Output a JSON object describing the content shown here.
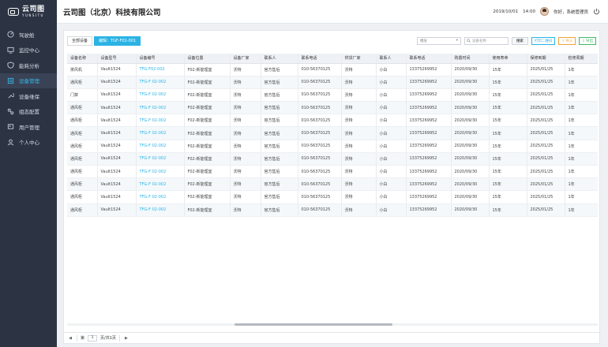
{
  "brand": {
    "cn": "云司图",
    "en": "YUNSITU"
  },
  "header": {
    "company": "云司图（北京）科技有限公司",
    "date": "2019/10/01",
    "time": "14:00",
    "greeting": "你好，系统管理员"
  },
  "sidebar": {
    "items": [
      {
        "label": "驾驶舱",
        "icon": "dashboard-icon",
        "active": false
      },
      {
        "label": "监控中心",
        "icon": "monitor-icon",
        "active": false
      },
      {
        "label": "能耗分析",
        "icon": "shield-icon",
        "active": false
      },
      {
        "label": "设备管理",
        "icon": "device-icon",
        "active": true
      },
      {
        "label": "设备维保",
        "icon": "wrench-icon",
        "active": false
      },
      {
        "label": "组态配置",
        "icon": "config-icon",
        "active": false
      },
      {
        "label": "用户管理",
        "icon": "users-icon",
        "active": false
      },
      {
        "label": "个人中心",
        "icon": "user-icon",
        "active": false
      }
    ]
  },
  "toolbar": {
    "all_devices": "全部设备",
    "filter_tag": "编辑：TGF-F01-001",
    "select_value": "楼层",
    "search_placeholder": "设备名称",
    "search_button": "搜索",
    "qr_button": "打印二维码",
    "import_button": "导入",
    "export_button": "导出"
  },
  "table": {
    "columns": [
      "设备名称",
      "设备型号",
      "设备编号",
      "设备位置",
      "设备厂家",
      "联系人",
      "联系电话",
      "供货厂家",
      "联系人",
      "联系电话",
      "购置时间",
      "使用寿命",
      "保修到期",
      "检修周期"
    ],
    "rows": [
      [
        "排风机",
        "Vault1524",
        "TFG-F02-002",
        "F02-新能理室",
        "沃特",
        "官方售后",
        "010-56370125",
        "沃特",
        "小白",
        "13375269952",
        "2020/09/30",
        "15年",
        "2025/01/25",
        "1年"
      ],
      [
        "通风柜",
        "Vault1524",
        "TFG-F 02-002",
        "F02-新能理室",
        "沃特",
        "官方售后",
        "010-56370125",
        "沃特",
        "小白",
        "13375269952",
        "2020/09/30",
        "15年",
        "2025/01/25",
        "1年"
      ],
      [
        "门禁",
        "Vault1524",
        "TFG-F 02-002",
        "F02-新能理室",
        "沃特",
        "官方售后",
        "010-56370125",
        "沃特",
        "小白",
        "13375269952",
        "2020/09/30",
        "15年",
        "2025/01/25",
        "1年"
      ],
      [
        "通风柜",
        "Vault1524",
        "TFG-F 02-002",
        "F02-新能理室",
        "沃特",
        "官方售后",
        "010-56370125",
        "沃特",
        "小白",
        "13375269952",
        "2020/09/30",
        "15年",
        "2025/01/25",
        "1年"
      ],
      [
        "通风柜",
        "Vault1524",
        "TFG-F 02-002",
        "F02-新能理室",
        "沃特",
        "官方售后",
        "010-56370125",
        "沃特",
        "小白",
        "13375269952",
        "2020/09/30",
        "15年",
        "2025/01/25",
        "1年"
      ],
      [
        "通风柜",
        "Vault1524",
        "TFG-F 02-002",
        "F02-新能理室",
        "沃特",
        "官方售后",
        "010-56370125",
        "沃特",
        "小白",
        "13375269952",
        "2020/09/30",
        "15年",
        "2025/01/25",
        "1年"
      ],
      [
        "通风柜",
        "Vault1524",
        "TFG-F 02-002",
        "F02-新能理室",
        "沃特",
        "官方售后",
        "010-56370125",
        "沃特",
        "小白",
        "13375269952",
        "2020/09/30",
        "15年",
        "2025/01/25",
        "1年"
      ],
      [
        "通风柜",
        "Vault1524",
        "TFG-F 02-002",
        "F02-新能理室",
        "沃特",
        "官方售后",
        "010-56370125",
        "沃特",
        "小白",
        "13375269952",
        "2020/09/30",
        "15年",
        "2025/01/25",
        "1年"
      ],
      [
        "通风柜",
        "Vault1524",
        "TFG-F 02-002",
        "F02-新能理室",
        "沃特",
        "官方售后",
        "010-56370125",
        "沃特",
        "小白",
        "13375269952",
        "2020/09/30",
        "15年",
        "2025/01/25",
        "1年"
      ],
      [
        "通风柜",
        "Vault1524",
        "TFG-F 02-002",
        "F02-新能理室",
        "沃特",
        "官方售后",
        "010-56370125",
        "沃特",
        "小白",
        "13375269952",
        "2020/09/30",
        "15年",
        "2025/01/25",
        "1年"
      ],
      [
        "通风柜",
        "Vault1524",
        "TFG-F 02-002",
        "F02-新能理室",
        "沃特",
        "官方售后",
        "010-56370125",
        "沃特",
        "小白",
        "13375269952",
        "2020/09/30",
        "15年",
        "2025/01/25",
        "1年"
      ],
      [
        "通风柜",
        "Vault1524",
        "TFG-F 02-002",
        "F02-新能理室",
        "沃特",
        "官方售后",
        "010-56370125",
        "沃特",
        "小白",
        "13375269952",
        "2020/09/30",
        "15年",
        "2025/01/25",
        "1年"
      ]
    ]
  },
  "pager": {
    "page_label": "第",
    "page_value": "1",
    "total_label": "页/共1页"
  },
  "colors": {
    "accent": "#2bb3e4",
    "sidebar": "#2c3444",
    "orange": "#f0a23c",
    "green": "#3dbb62"
  }
}
